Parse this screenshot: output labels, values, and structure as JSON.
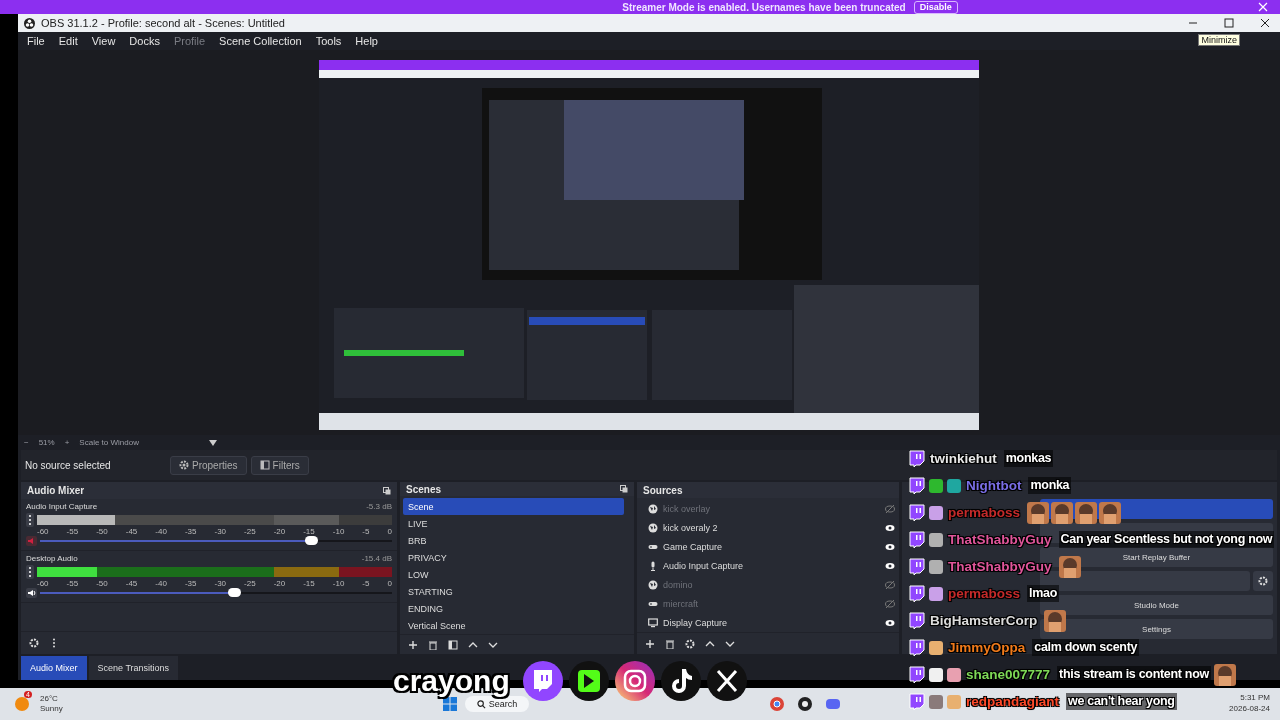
{
  "banner": {
    "text": "Streamer Mode is enabled. Usernames have been truncated",
    "button": "Disable"
  },
  "window": {
    "title": "OBS 31.1.2 - Profile: second alt - Scenes: Untitled",
    "tooltip": "Minimize"
  },
  "menu": [
    {
      "label": "File",
      "disabled": false
    },
    {
      "label": "Edit",
      "disabled": false
    },
    {
      "label": "View",
      "disabled": false
    },
    {
      "label": "Docks",
      "disabled": false
    },
    {
      "label": "Profile",
      "disabled": true
    },
    {
      "label": "Scene Collection",
      "disabled": false
    },
    {
      "label": "Tools",
      "disabled": false
    },
    {
      "label": "Help",
      "disabled": false
    }
  ],
  "preview": {
    "kind": "picture"
  },
  "zoom_bar": {
    "minus": "−",
    "zoom": "51%",
    "plus": "+",
    "scale": "Scale to Window"
  },
  "source_bar": {
    "status": "No source selected",
    "buttons": [
      "Properties",
      "Filters"
    ]
  },
  "audio_mixer": {
    "title": "Audio Mixer",
    "channels": [
      {
        "name": "Audio Input Capture",
        "reading": "-5.3 dB",
        "muted": true,
        "meter": {
          "level": 0.22
        },
        "volume": {
          "level": 0.77
        },
        "scale": [
          "-60",
          "-55",
          "-50",
          "-45",
          "-40",
          "-35",
          "-30",
          "-25",
          "-20",
          "-15",
          "-10",
          "-5",
          "0"
        ]
      },
      {
        "name": "Desktop Audio",
        "reading": "-15.4 dB",
        "muted": false,
        "meter": {
          "level": 0.17
        },
        "volume": {
          "level": 0.55
        },
        "scale": [
          "-60",
          "-55",
          "-50",
          "-45",
          "-40",
          "-35",
          "-30",
          "-25",
          "-20",
          "-15",
          "-10",
          "-5",
          "0"
        ]
      }
    ]
  },
  "scenes": {
    "title": "Scenes",
    "items": [
      {
        "label": "Scene",
        "selected": true
      },
      {
        "label": "LIVE",
        "selected": false
      },
      {
        "label": "BRB",
        "selected": false
      },
      {
        "label": "PRIVACY",
        "selected": false
      },
      {
        "label": "LOW",
        "selected": false
      },
      {
        "label": "STARTING",
        "selected": false
      },
      {
        "label": "ENDING",
        "selected": false
      },
      {
        "label": "Vertical Scene",
        "selected": false
      }
    ]
  },
  "sources": {
    "title": "Sources",
    "items": [
      {
        "label": "kick overlay",
        "kind": "browser",
        "visible": false
      },
      {
        "label": "kick overaly 2",
        "kind": "browser",
        "visible": true
      },
      {
        "label": "Game Capture",
        "kind": "game",
        "visible": true
      },
      {
        "label": "Audio Input Capture",
        "kind": "mic",
        "visible": true
      },
      {
        "label": "domino",
        "kind": "browser",
        "visible": false
      },
      {
        "label": "miercraft",
        "kind": "game",
        "visible": false
      },
      {
        "label": "Display Capture",
        "kind": "display",
        "visible": true
      }
    ]
  },
  "controls": [
    {
      "kind": "button",
      "active": true
    },
    {
      "kind": "button",
      "active": false
    },
    {
      "kind": "button",
      "active": false,
      "label": "Start Replay Buffer"
    },
    {
      "kind": "split",
      "active": false
    },
    {
      "kind": "button",
      "active": false,
      "label": "Studio Mode"
    },
    {
      "kind": "button",
      "active": false,
      "label": "Settings"
    }
  ],
  "dock_tabs": [
    {
      "label": "Audio Mixer",
      "selected": true
    },
    {
      "label": "Scene Transitions",
      "selected": false
    }
  ],
  "chat": [
    {
      "user": "twinkiehut",
      "color": "#e8e8e8",
      "text": "monkas"
    },
    {
      "user": "Nightbot",
      "color": "#7a6ee6",
      "badges": [
        {
          "color": "#2eb82e"
        },
        {
          "color": "#1fa7a0"
        }
      ],
      "text": "monka"
    },
    {
      "user": "permaboss",
      "color": "#c42a2a",
      "badges": [
        {
          "color": "#c9a0e8"
        }
      ],
      "emotes": [
        {
          "kind": "picture"
        },
        {
          "kind": "picture"
        },
        {
          "kind": "picture"
        },
        {
          "kind": "picture"
        }
      ]
    },
    {
      "user": "ThatShabbyGuy",
      "color": "#e0559a",
      "badges": [
        {
          "color": "#b0b0b0"
        }
      ],
      "text": "Can year Scentless but not yong now"
    },
    {
      "user": "ThatShabbyGuy",
      "color": "#e0559a",
      "badges": [
        {
          "color": "#b0b0b0"
        }
      ],
      "emotes": [
        {
          "kind": "picture"
        }
      ]
    },
    {
      "user": "permaboss",
      "color": "#c42a2a",
      "badges": [
        {
          "color": "#c9a0e8"
        }
      ],
      "text": "lmao"
    },
    {
      "user": "BigHamsterCorp",
      "color": "#dcdcdc",
      "emotes": [
        {
          "kind": "picture"
        }
      ]
    },
    {
      "user": "JimmyOppa",
      "color": "#f07a1a",
      "badges": [
        {
          "color": "#e8b070"
        }
      ],
      "text": "calm down scenty"
    },
    {
      "user": "shane007777",
      "color": "#7ed957",
      "badges": [
        {
          "color": "#f0f0f0"
        },
        {
          "color": "#e8a0b0"
        }
      ],
      "text": "this stream is content now",
      "emotes": [
        {
          "kind": "picture"
        }
      ]
    },
    {
      "user": "redpandagiant",
      "color": "#ff4a2a",
      "badges": [
        {
          "color": "#8a7a7a"
        },
        {
          "color": "#e8b070"
        }
      ],
      "text": "we can't hear yong"
    }
  ],
  "overlay": {
    "name": "crayong"
  },
  "taskbar": {
    "weather_badge": "4",
    "temperature": "26°C",
    "condition": "Sunny",
    "search": "Search",
    "time": "5:31 PM",
    "date": "2026-08-24"
  }
}
